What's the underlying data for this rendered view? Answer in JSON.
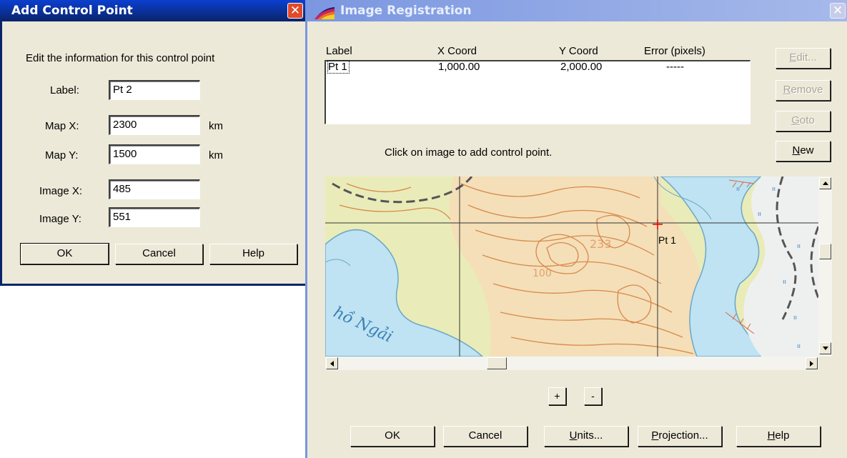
{
  "add_dialog": {
    "title": "Add Control Point",
    "instructions": "Edit the information for this control point",
    "label_field": {
      "label": "Label:",
      "value": "Pt 2"
    },
    "map_x": {
      "label": "Map X:",
      "value": "2300",
      "unit": "km"
    },
    "map_y": {
      "label": "Map Y:",
      "value": "1500",
      "unit": "km"
    },
    "image_x": {
      "label": "Image X:",
      "value": "485"
    },
    "image_y": {
      "label": "Image Y:",
      "value": "551"
    },
    "ok": "OK",
    "cancel": "Cancel",
    "help": "Help"
  },
  "registration": {
    "title": "Image Registration",
    "columns": [
      "Label",
      "X Coord",
      "Y Coord",
      "Error (pixels)"
    ],
    "rows": [
      {
        "label": "Pt 1",
        "x": "1,000.00",
        "y": "2,000.00",
        "error": "-----"
      }
    ],
    "side_buttons": {
      "edit": "Edit...",
      "remove": "Remove",
      "goto": "Goto",
      "new": "New"
    },
    "hint": "Click on image to add control point.",
    "map_point_label": "Pt 1",
    "map_text": {
      "lake": "hồ Ngải",
      "contour_label_1": "233",
      "contour_label_2": "100"
    },
    "zoom_in": "+",
    "zoom_out": "-",
    "bottom_buttons": {
      "ok": "OK",
      "cancel": "Cancel",
      "units": "Units...",
      "projection": "Projection...",
      "help": "Help"
    }
  },
  "colors": {
    "title_bar": "#0a246a",
    "close_red": "#e04a2a",
    "water": "#bfe3f2",
    "land": "#e9ecb8",
    "contour": "#d9884a"
  }
}
